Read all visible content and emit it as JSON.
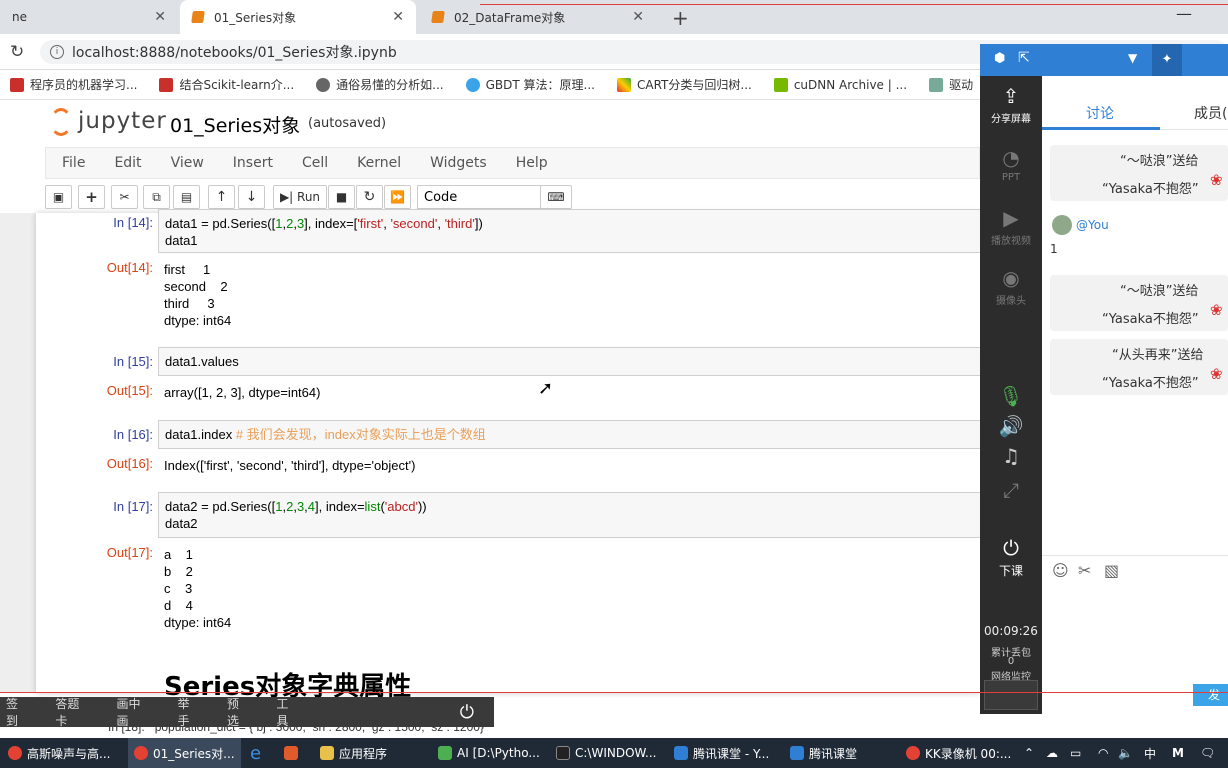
{
  "browser": {
    "tabs": [
      {
        "label": "ne"
      },
      {
        "label": "01_Series对象"
      },
      {
        "label": "02_DataFrame对象"
      }
    ],
    "url": "localhost:8888/notebooks/01_Series对象.ipynb",
    "bookmarks": [
      "程序员的机器学习...",
      "结合Scikit-learn介...",
      "通俗易懂的分析如...",
      "GBDT 算法：原理...",
      "CART分类与回归树...",
      "cuDNN Archive | ...",
      "驱动"
    ]
  },
  "jupyter": {
    "logo_text": "jupyter",
    "notebook_name": "01_Series对象",
    "save_status": "(autosaved)",
    "menu": [
      "File",
      "Edit",
      "View",
      "Insert",
      "Cell",
      "Kernel",
      "Widgets",
      "Help"
    ],
    "run_label": "Run",
    "cell_type": "Code",
    "cells": [
      {
        "in_prompt": "In [14]:",
        "out_prompt": "Out[14]:",
        "output": "first     1\nsecond    2\nthird     3\ndtype: int64"
      },
      {
        "in_prompt": "In [15]:",
        "out_prompt": "Out[15]:",
        "output": "array([1, 2, 3], dtype=int64)"
      },
      {
        "in_prompt": "In [16]:",
        "out_prompt": "Out[16]:",
        "output": "Index(['first', 'second', 'third'], dtype='object')"
      },
      {
        "in_prompt": "In [17]:",
        "out_prompt": "Out[17]:",
        "output": "a    1\nb    2\nc    3\nd    4\ndtype: int64"
      }
    ],
    "code_14": {
      "a": "data1 = pd.Series([",
      "n1": "1",
      "c1": ",",
      "n2": "2",
      "c2": ",",
      "n3": "3",
      "b": "], index=[",
      "s1": "'first'",
      "d1": ", ",
      "s2": "'second'",
      "d2": ", ",
      "s3": "'third'",
      "e": "])\ndata1"
    },
    "code_15": "data1.values",
    "code_16": {
      "code": "data1.index ",
      "comment": "# 我们会发现，index对象实际上也是个数组"
    },
    "code_17": {
      "a": "data2 = pd.Series([",
      "n1": "1",
      "c1": ",",
      "n2": "2",
      "c2": ",",
      "n3": "3",
      "c3": ",",
      "n4": "4",
      "b": "], index=",
      "kw": "list",
      "p1": "(",
      "s1": "'abcd'",
      "e": "))\ndata2"
    },
    "markdown_heading": "Series对象字典属性",
    "partial_next": "In [18]:   population_dict = { bj : 3000,  sh : 2800,  gz : 1500,  sz : 1200}"
  },
  "classroom": {
    "sidebar": [
      {
        "label": "分享屏幕",
        "icon": "share-screen-icon"
      },
      {
        "label": "PPT",
        "icon": "ppt-icon"
      },
      {
        "label": "播放视频",
        "icon": "play-video-icon"
      },
      {
        "label": "摄像头",
        "icon": "camera-icon"
      },
      {
        "label": "下课",
        "icon": "end-class-icon"
      }
    ],
    "timer": "00:09:26",
    "stats1": "累计丢包",
    "stats2": "0",
    "stats3": "网络监控",
    "tabs": [
      "讨论",
      "成员("
    ],
    "messages": [
      {
        "type": "gift",
        "line1": "“～哒浪”送给",
        "line2": "“Yasaka不抱怨”"
      },
      {
        "type": "user",
        "name": "@You",
        "text": "1"
      },
      {
        "type": "gift",
        "line1": "“～哒浪”送给",
        "line2": "“Yasaka不抱怨”"
      },
      {
        "type": "gift",
        "line1": "“从头再来”送给",
        "line2": "“Yasaka不抱怨”"
      }
    ],
    "send_label": "发"
  },
  "bottom_toolbar": [
    "签到",
    "答题卡",
    "画中画",
    "举手",
    "预选",
    "工具"
  ],
  "taskbar": [
    "高斯噪声与高...",
    "01_Series对...",
    "应用程序",
    "AI [D:\\Pytho...",
    "C:\\WINDOW...",
    "腾讯课堂 - Y...",
    "腾讯课堂",
    "KK录像机 00:..."
  ],
  "tray": {
    "ime": "中",
    "m": "M"
  }
}
